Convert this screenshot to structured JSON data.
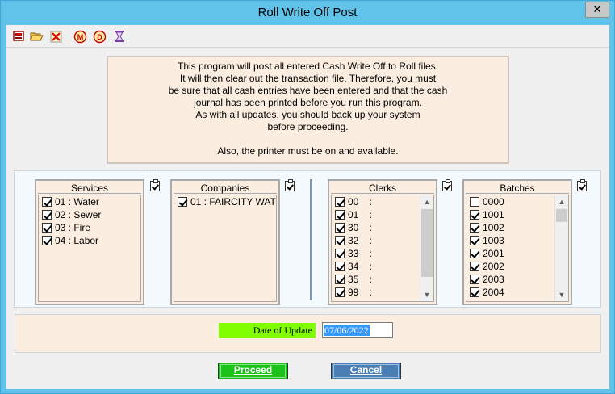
{
  "window": {
    "title": "Roll Write Off Post",
    "close_label": "✕"
  },
  "toolbar": {
    "icons": [
      "print-icon",
      "open-folder-icon",
      "delete-icon",
      "m-icon",
      "d-icon",
      "hourglass-icon"
    ],
    "m_label": "M",
    "d_label": "D"
  },
  "info": {
    "lines": [
      "This program will post all entered Cash Write Off to Roll files.",
      "It will then clear out the transaction file. Therefore, you must",
      "be sure that all cash entries have been entered and that the cash",
      "journal has been printed before you run this program.",
      "As with all updates, you should back up your system",
      "before proceeding.",
      "",
      "Also, the printer must be on and available."
    ]
  },
  "services": {
    "header": "Services",
    "items": [
      {
        "label": "01 : Water",
        "checked": true
      },
      {
        "label": "02 : Sewer",
        "checked": true
      },
      {
        "label": "03 : Fire",
        "checked": true
      },
      {
        "label": "04 : Labor",
        "checked": true
      }
    ]
  },
  "companies": {
    "header": "Companies",
    "items": [
      {
        "label": "01 : FAIRCITY WAT",
        "checked": true
      }
    ]
  },
  "clerks": {
    "header": "Clerks",
    "items": [
      {
        "label": "00    :",
        "checked": true
      },
      {
        "label": "01    :",
        "checked": true
      },
      {
        "label": "30    :",
        "checked": true
      },
      {
        "label": "32    :",
        "checked": true
      },
      {
        "label": "33    :",
        "checked": true
      },
      {
        "label": "34    :",
        "checked": true
      },
      {
        "label": "35    :",
        "checked": true
      },
      {
        "label": "99    :",
        "checked": true
      }
    ]
  },
  "batches": {
    "header": "Batches",
    "items": [
      {
        "label": "0000",
        "checked": false
      },
      {
        "label": "1001",
        "checked": true
      },
      {
        "label": "1002",
        "checked": true
      },
      {
        "label": "1003",
        "checked": true
      },
      {
        "label": "2001",
        "checked": true
      },
      {
        "label": "2002",
        "checked": true
      },
      {
        "label": "2003",
        "checked": true
      },
      {
        "label": "2004",
        "checked": true
      }
    ]
  },
  "date": {
    "label": "Date of Update",
    "value": "07/06/2022"
  },
  "buttons": {
    "proceed": "Proceed",
    "cancel": "Cancel"
  },
  "colors": {
    "title_bg": "#62c3ea",
    "panel_bg": "#fbeee0",
    "proceed_bg": "#1ac21a",
    "cancel_bg": "#4a7fb6",
    "date_label_bg": "#80ff00",
    "selection": "#3399ff"
  }
}
